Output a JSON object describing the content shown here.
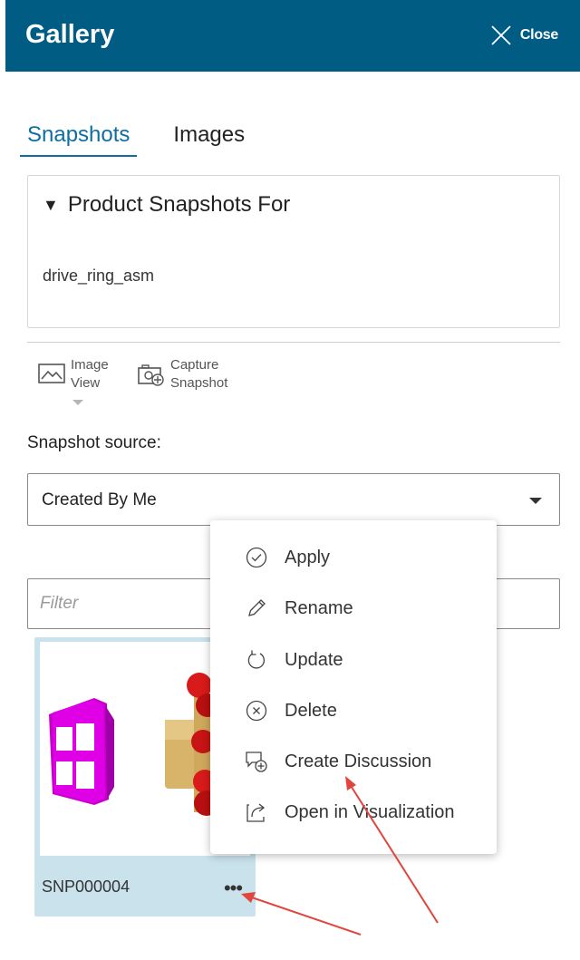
{
  "header": {
    "title": "Gallery",
    "close_label": "Close"
  },
  "tabs": [
    {
      "label": "Snapshots",
      "active": true
    },
    {
      "label": "Images",
      "active": false
    }
  ],
  "panel": {
    "title": "Product Snapshots For",
    "product_name": "drive_ring_asm"
  },
  "toolbar": {
    "image_view": {
      "line1": "Image",
      "line2": "View"
    },
    "capture_snapshot": {
      "line1": "Capture",
      "line2": "Snapshot"
    }
  },
  "source": {
    "label": "Snapshot source:",
    "selected": "Created By Me"
  },
  "filter": {
    "placeholder": "Filter",
    "value": ""
  },
  "card": {
    "name": "SNP000004",
    "more_label": "•••"
  },
  "context_menu": {
    "items": [
      {
        "label": "Apply",
        "icon": "check-circle-icon"
      },
      {
        "label": "Rename",
        "icon": "pencil-icon"
      },
      {
        "label": "Update",
        "icon": "refresh-icon"
      },
      {
        "label": "Delete",
        "icon": "x-circle-icon"
      },
      {
        "label": "Create Discussion",
        "icon": "discussion-add-icon"
      },
      {
        "label": "Open in Visualization",
        "icon": "open-external-icon"
      }
    ]
  },
  "colors": {
    "header_bg": "#005c83",
    "tab_active": "#0d6fa1",
    "card_bg": "#c9e2ec",
    "annotation_arrow": "#e0463d"
  }
}
